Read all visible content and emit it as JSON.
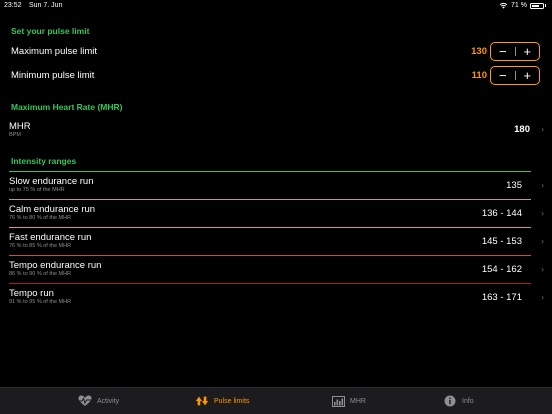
{
  "status_bar": {
    "time": "23:52",
    "date": "Sun 7. Jun",
    "battery_text": "71 %",
    "battery_level": 0.71
  },
  "pulse_limit": {
    "title": "Set your pulse limit",
    "max_label": "Maximum pulse limit",
    "max_value": "130",
    "min_label": "Minimum pulse limit",
    "min_value": "110",
    "minus": "−",
    "plus": "+"
  },
  "mhr": {
    "title": "Maximum Heart Rate (MHR)",
    "label": "MHR",
    "unit": "BPM",
    "value": "180"
  },
  "intensity": {
    "title": "Intensity ranges",
    "ranges": [
      {
        "name": "Slow endurance run",
        "desc": "up to 75 % of the MHR",
        "value": "135",
        "color": "#34c759"
      },
      {
        "name": "Calm endurance run",
        "desc": "76 % to 80 % of the MHR",
        "value": "136 - 144",
        "color": "#c7a23a"
      },
      {
        "name": "Fast endurance run",
        "desc": "76 % to 85 % of the MHR",
        "value": "145 - 153",
        "color": "#e0a030"
      },
      {
        "name": "Tempo endurance run",
        "desc": "86 % to 90 % of the MHR",
        "value": "154 - 162",
        "color": "#c8502a"
      },
      {
        "name": "Tempo run",
        "desc": "91 % to 95 % of the MHR",
        "value": "163 - 171",
        "color": "#b8161a"
      }
    ]
  },
  "tabs": [
    {
      "label": "Activity",
      "icon": "heart-pulse-icon"
    },
    {
      "label": "Pulse limits",
      "icon": "up-down-arrows-icon"
    },
    {
      "label": "MHR",
      "icon": "bar-graph-icon"
    },
    {
      "label": "Info",
      "icon": "info-icon"
    }
  ],
  "colors": {
    "accent": "#ff9500",
    "section_title": "#34c759"
  }
}
